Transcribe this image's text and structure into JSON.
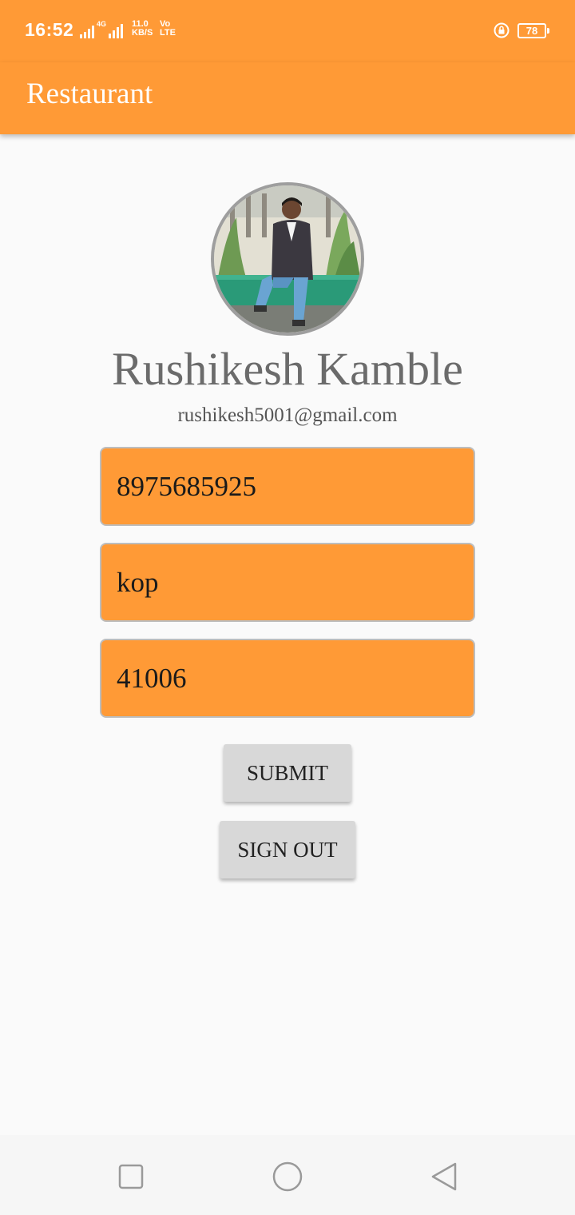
{
  "status_bar": {
    "time": "16:52",
    "network_tag": "4G",
    "speed_value": "11.0",
    "speed_unit": "KB/S",
    "volte_top": "Vo",
    "volte_bottom": "LTE",
    "battery": "78",
    "icons": [
      "signal-icon",
      "signal-icon",
      "rotation-lock-icon",
      "battery-icon"
    ]
  },
  "app_bar": {
    "title": "Restaurant"
  },
  "profile": {
    "name": "Rushikesh Kamble",
    "email": "rushikesh5001@gmail.com"
  },
  "form": {
    "phone": "8975685925",
    "city": "kop",
    "pincode": "41006"
  },
  "buttons": {
    "submit": "SUBMIT",
    "sign_out": "SIGN OUT"
  },
  "colors": {
    "accent": "#ff9a36",
    "button_bg": "#d8d8d8",
    "background": "#fafafa"
  },
  "nav_icons": [
    "recents-square-icon",
    "home-circle-icon",
    "back-triangle-icon"
  ]
}
